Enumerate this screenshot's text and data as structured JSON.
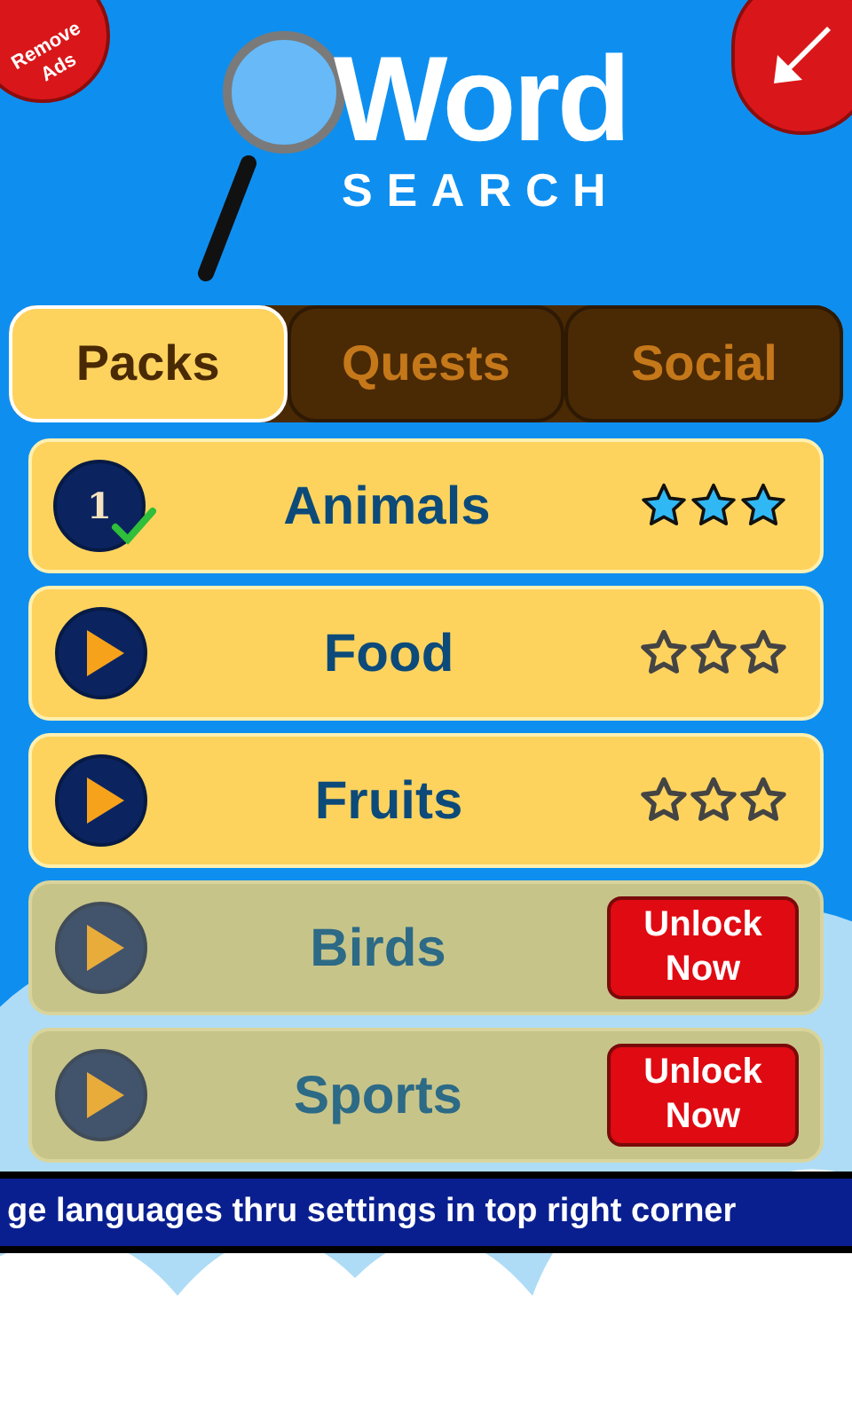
{
  "remove_ads": "Remove Ads",
  "logo": {
    "title": "Word",
    "subtitle": "SEARCH"
  },
  "tabs": [
    {
      "label": "Packs",
      "selected": true
    },
    {
      "label": "Quests",
      "selected": false
    },
    {
      "label": "Social",
      "selected": false
    }
  ],
  "packs": [
    {
      "name": "Animals",
      "kind": "completed",
      "badge": "1",
      "locked": false,
      "stars": 3
    },
    {
      "name": "Food",
      "kind": "play",
      "locked": false,
      "stars": 0
    },
    {
      "name": "Fruits",
      "kind": "play",
      "locked": false,
      "stars": 0
    },
    {
      "name": "Birds",
      "kind": "play",
      "locked": true,
      "unlock": "Unlock Now"
    },
    {
      "name": "Sports",
      "kind": "play",
      "locked": true,
      "unlock": "Unlock Now"
    }
  ],
  "ticker": "ge languages thru settings in top right corner"
}
